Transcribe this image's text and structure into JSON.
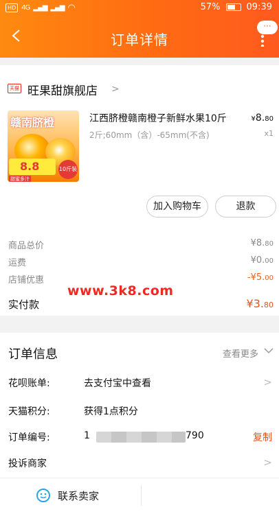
{
  "status": {
    "carrier_chip": "HD",
    "network": "4G",
    "battery": "57%",
    "time": "09:39"
  },
  "header": {
    "title": "订单详情",
    "bubble": "···"
  },
  "shop": {
    "tag": "天猫",
    "name": "旺果甜旗舰店"
  },
  "product": {
    "image_title": "赣南脐橙",
    "image_price": "8.8",
    "image_badge": "首件",
    "image_sub": "甜蜜多汁",
    "image_weight": "10斤装",
    "name": "江西脐橙赣南橙子新鲜水果10斤",
    "price_symbol": "¥",
    "price_int": "8.",
    "price_dec": "80",
    "spec": "2斤;60mm（含）-65mm(不含)",
    "qty": "x1"
  },
  "actions": {
    "add_cart": "加入购物车",
    "refund": "退款"
  },
  "summary": {
    "goods_label": "商品总价",
    "goods_amt": "¥8.",
    "goods_dec": "80",
    "ship_label": "运费",
    "ship_amt": "¥0.",
    "ship_dec": "00",
    "disc_label": "店铺优惠",
    "disc_amt": "-¥5.",
    "disc_dec": "00",
    "paid_label": "实付款",
    "paid_amt": "¥3.",
    "paid_dec": "80"
  },
  "watermark": "www.3k8.com",
  "order_info": {
    "title": "订单信息",
    "see_more": "查看更多",
    "rows": [
      {
        "label": "花呗账单:",
        "value": "去支付宝中查看"
      },
      {
        "label": "天猫积分:",
        "value": "获得1点积分"
      },
      {
        "label": "订单编号:",
        "value_prefix": "1",
        "value_suffix": "790",
        "copy": "复制"
      },
      {
        "label": "投诉商家"
      }
    ]
  },
  "footer": {
    "contact": "联系卖家"
  }
}
